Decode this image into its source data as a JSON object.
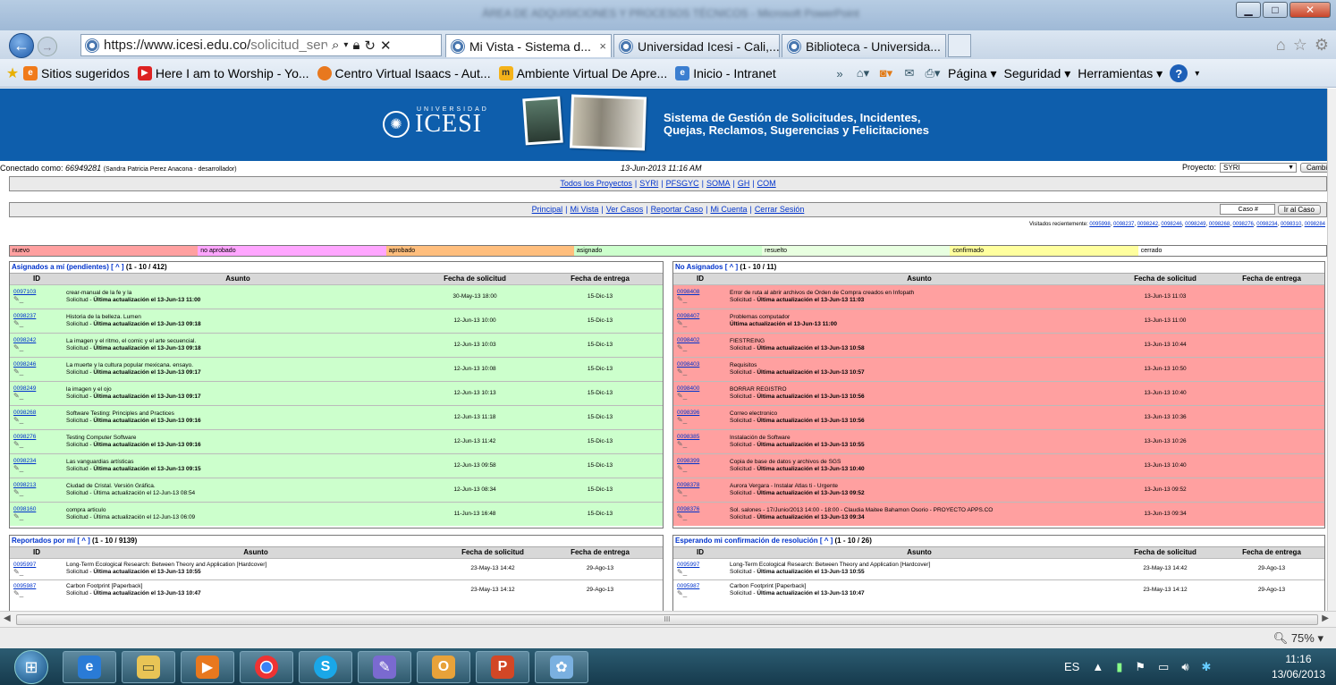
{
  "browser": {
    "url_host": "https://www.icesi.edu.co/",
    "url_path": "solicitud_servic",
    "window_title": "ÁREA DE ADQUISICIONES Y PROCESOS TÉCNICOS - Microsoft PowerPoint",
    "tabs": [
      {
        "label": "Mi Vista - Sistema d...",
        "active": true
      },
      {
        "label": "Universidad Icesi - Cali,...",
        "active": false
      },
      {
        "label": "Biblioteca - Universida...",
        "active": false
      }
    ],
    "favorites": [
      "Sitios sugeridos",
      "Here I am to Worship - Yo...",
      "Centro Virtual Isaacs - Aut...",
      "Ambiente Virtual De Apre...",
      "Inicio - Intranet"
    ],
    "tools": {
      "pagina": "Página ▾",
      "seguridad": "Seguridad ▾",
      "herramientas": "Herramientas ▾"
    },
    "zoom": "75%",
    "scroll_grip": "III"
  },
  "site": {
    "university_label": "UNIVERSIDAD",
    "logo_text": "ICESI",
    "slogan_line1": "Sistema de Gestión de Solicitudes, Incidentes,",
    "slogan_line2": "Quejas, Reclamos, Sugerencias y Felicitaciones",
    "connected_prefix": "Conectado como: ",
    "user_id": "66949281",
    "user_desc": "(Sandra Patricia Perez Anacona - desarrollador)",
    "datetime": "13-Jun-2013 11:16 AM",
    "project_label": "Proyecto:",
    "project_value": "SYRI",
    "change_button": "Cambiar",
    "project_links": [
      "Todos los Proyectos",
      "SYRI",
      "PFSGYC",
      "SOMA",
      "GH",
      "COM"
    ],
    "menu_links": [
      "Principal",
      "Mi Vista",
      "Ver Casos",
      "Reportar Caso",
      "Mi Cuenta",
      "Cerrar Sesión"
    ],
    "case_input_placeholder": "Caso #",
    "go_case_button": "Ir al Caso",
    "visited_label": "Visitados recientemente: ",
    "visited_ids": [
      "0098237",
      "0098242",
      "0098246",
      "0098249",
      "0098268",
      "0098276",
      "0098234",
      "0098310",
      "0098284"
    ],
    "visited_first": "0095998",
    "legend": [
      {
        "label": "nuevo",
        "color": "#ffa0a0"
      },
      {
        "label": "no aprobado",
        "color": "#ffa6ff"
      },
      {
        "label": "aprobado",
        "color": "#ffbe7d"
      },
      {
        "label": "asignado",
        "color": "#ccffcc"
      },
      {
        "label": "resuelto",
        "color": "#e8ffe0"
      },
      {
        "label": "confirmado",
        "color": "#ffff9e"
      },
      {
        "label": "cerrado",
        "color": "#ffffff"
      }
    ]
  },
  "columns": {
    "id": "ID",
    "asunto": "Asunto",
    "fecha_sol": "Fecha de solicitud",
    "fecha_ent": "Fecha de entrega"
  },
  "panels": {
    "asignados": {
      "title": "Asignados a mí (pendientes)",
      "nav": "[ ^ ]",
      "count": "(1 - 10 / 412)",
      "rows": [
        {
          "id": "0097103",
          "title": "crear-manual de la fe y la",
          "status": "Solicitud - ",
          "update": "Última actualización el 13-Jun-13 11:00",
          "bold": true,
          "fecha": "30-May-13 18:00",
          "entrega": "15-Dic-13"
        },
        {
          "id": "0098237",
          "title": "Historia de la belleza. Lumen",
          "status": "Solicitud - ",
          "update": "Última actualización el 13-Jun-13 09:18",
          "bold": true,
          "fecha": "12-Jun-13 10:00",
          "entrega": "15-Dic-13"
        },
        {
          "id": "0098242",
          "title": "La imagen y el ritmo, el comic y el arte secuencial.",
          "status": "Solicitud - ",
          "update": "Última actualización el 13-Jun-13 09:18",
          "bold": true,
          "fecha": "12-Jun-13 10:03",
          "entrega": "15-Dic-13"
        },
        {
          "id": "0098246",
          "title": "La muerte y la cultura popular mexicana. ensayo.",
          "status": "Solicitud - ",
          "update": "Última actualización el 13-Jun-13 09:17",
          "bold": true,
          "fecha": "12-Jun-13 10:08",
          "entrega": "15-Dic-13"
        },
        {
          "id": "0098249",
          "title": "la imagen y el ojo",
          "status": "Solicitud - ",
          "update": "Última actualización el 13-Jun-13 09:17",
          "bold": true,
          "fecha": "12-Jun-13 10:13",
          "entrega": "15-Dic-13"
        },
        {
          "id": "0098268",
          "title": "Software Testing: Principles and Practices",
          "status": "Solicitud - ",
          "update": "Última actualización el 13-Jun-13 09:16",
          "bold": true,
          "fecha": "12-Jun-13 11:18",
          "entrega": "15-Dic-13"
        },
        {
          "id": "0098276",
          "title": "Testing Computer Software",
          "status": "Solicitud - ",
          "update": "Última actualización el 13-Jun-13 09:16",
          "bold": true,
          "fecha": "12-Jun-13 11:42",
          "entrega": "15-Dic-13"
        },
        {
          "id": "0098234",
          "title": "Las vanguardias artísticas",
          "status": "Solicitud - ",
          "update": "Última actualización el 13-Jun-13 09:15",
          "bold": true,
          "fecha": "12-Jun-13 09:58",
          "entrega": "15-Dic-13"
        },
        {
          "id": "0098213",
          "title": "Ciudad de Cristal. Versión Gráfica.",
          "status": "Solicitud - ",
          "update": "Última actualización el 12-Jun-13 08:54",
          "bold": false,
          "fecha": "12-Jun-13 08:34",
          "entrega": "15-Dic-13"
        },
        {
          "id": "0098160",
          "title": "compra articulo",
          "status": "Solicitud - ",
          "update": "Última actualización el 12-Jun-13 06:09",
          "bold": false,
          "fecha": "11-Jun-13 16:48",
          "entrega": "15-Dic-13"
        }
      ]
    },
    "noasignados": {
      "title": "No Asignados",
      "nav": "[ ^ ]",
      "count": "(1 - 10 / 11)",
      "rows": [
        {
          "id": "0098408",
          "title": "Error de ruta al abrir archivos de Orden de Compra creados en Infopath",
          "status": "Solicitud - ",
          "update": "Última actualización el 13-Jun-13 11:03",
          "bold": true,
          "fecha": "13-Jun-13 11:03",
          "entrega": ""
        },
        {
          "id": "0098407",
          "title": "Problemas computador",
          "status": "",
          "update": "Última actualización el 13-Jun-13 11:00",
          "bold": true,
          "fecha": "13-Jun-13 11:00",
          "entrega": ""
        },
        {
          "id": "0098402",
          "title": "FIESTREING",
          "status": "Solicitud - ",
          "update": "Última actualización el 13-Jun-13 10:58",
          "bold": true,
          "fecha": "13-Jun-13 10:44",
          "entrega": ""
        },
        {
          "id": "0098403",
          "title": "Requisitos",
          "status": "Solicitud - ",
          "update": "Última actualización el 13-Jun-13 10:57",
          "bold": true,
          "fecha": "13-Jun-13 10:50",
          "entrega": ""
        },
        {
          "id": "0098400",
          "title": "BORRAR REGISTRO",
          "status": "Solicitud - ",
          "update": "Última actualización el 13-Jun-13 10:56",
          "bold": true,
          "fecha": "13-Jun-13 10:40",
          "entrega": ""
        },
        {
          "id": "0098396",
          "title": "Correo electronico",
          "status": "Solicitud - ",
          "update": "Última actualización el 13-Jun-13 10:56",
          "bold": true,
          "fecha": "13-Jun-13 10:36",
          "entrega": ""
        },
        {
          "id": "0098385",
          "title": "Instalación de Software",
          "status": "Solicitud - ",
          "update": "Última actualización el 13-Jun-13 10:55",
          "bold": true,
          "fecha": "13-Jun-13 10:26",
          "entrega": ""
        },
        {
          "id": "0098399",
          "title": "Copia de base de datos y archivos de SGS",
          "status": "Solicitud - ",
          "update": "Última actualización el 13-Jun-13 10:40",
          "bold": true,
          "fecha": "13-Jun-13 10:40",
          "entrega": ""
        },
        {
          "id": "0098378",
          "title": "Aurora Vergara - Instalar Atlas ti - Urgente",
          "status": "Solicitud - ",
          "update": "Última actualización el 13-Jun-13 09:52",
          "bold": true,
          "fecha": "13-Jun-13 09:52",
          "entrega": ""
        },
        {
          "id": "0098376",
          "title": "Sol. salones - 17/Junio/2013 14:00 - 18:00 - Claudia Maitee Bahamon Osorio - PROYECTO APPS.CO",
          "status": "Solicitud - ",
          "update": "Última actualización el 13-Jun-13 09:34",
          "bold": true,
          "fecha": "13-Jun-13 09:34",
          "entrega": ""
        }
      ]
    },
    "reportados": {
      "title": "Reportados por mí",
      "nav": "[ ^ ]",
      "count": "(1 - 10 / 9139)",
      "rows": [
        {
          "id": "0095997",
          "title": "Long-Term Ecological Research: Between Theory and Application [Hardcover]",
          "status": "Solicitud - ",
          "update": "Última actualización el 13-Jun-13 10:55",
          "bold": true,
          "fecha": "23-May-13 14:42",
          "entrega": "29-Ago-13"
        },
        {
          "id": "0095987",
          "title": "Carbon Footprint [Paperback]",
          "status": "Solicitud - ",
          "update": "Última actualización el 13-Jun-13 10:47",
          "bold": true,
          "fecha": "23-May-13 14:12",
          "entrega": "29-Ago-13"
        }
      ]
    },
    "esperando": {
      "title": "Esperando mi confirmación de resolución",
      "nav": "[ ^ ]",
      "count": "(1 - 10 / 26)",
      "rows": [
        {
          "id": "0095997",
          "title": "Long-Term Ecological Research: Between Theory and Application [Hardcover]",
          "status": "Solicitud - ",
          "update": "Última actualización el 13-Jun-13 10:55",
          "bold": true,
          "fecha": "23-May-13 14:42",
          "entrega": "29-Ago-13"
        },
        {
          "id": "0095987",
          "title": "Carbon Footprint [Paperback]",
          "status": "Solicitud - ",
          "update": "Última actualización el 13-Jun-13 10:47",
          "bold": true,
          "fecha": "23-May-13 14:12",
          "entrega": "29-Ago-13"
        }
      ]
    }
  },
  "taskbar": {
    "lang": "ES",
    "time": "11:16",
    "date": "13/06/2013"
  }
}
